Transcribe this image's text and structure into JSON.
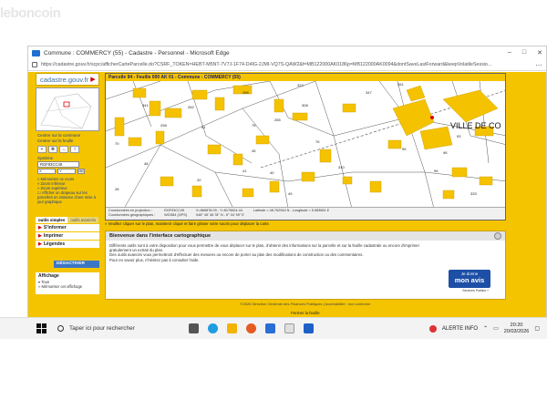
{
  "watermark": "leboncoin",
  "browser": {
    "title": "Commune : COMMERCY (55) - Cadastre - Personnel - Microsoft Edge",
    "url": "https://cadastre.gouv.fr/scpc/afficherCarteParcelle.do?CSRF_TOKEN=HEBT-M5NT-7V7J-1F74-D4IG-2JMI-VQ7S-QAW2&f=MB122000AK0186p=MB122000AK0094&dontSaveLastForward&keepVolatileSessio..."
  },
  "sidebar": {
    "logo": "cadastre.gouv.fr",
    "nav_links": [
      "Centrer sur la commune",
      "Centrer sur la feuille"
    ],
    "tool_icons": [
      "zoom-icon",
      "pan-icon",
      "measure-icon",
      "info-icon"
    ],
    "system_label": "Système",
    "system_value": "RGF93CC49",
    "coord_placeholder_x": "X",
    "coord_placeholder_y": "Y",
    "coord_ok": "OK",
    "tools_links": [
      "Mémoriser ce cours",
      "Zoom inférieur",
      "Zoom supérieur",
      "Afficher un drapeau sur les parcelles en instance d'une mise à jour graphique"
    ],
    "tabs": [
      "outils simples",
      "outils avancés"
    ],
    "menu": [
      "S'informer",
      "Imprimer",
      "Légendes"
    ],
    "deactivate": "DÉSACTIVER",
    "display_title": "Affichage",
    "display_options": [
      "Tous",
      "Mémoriser cet affichage"
    ]
  },
  "map": {
    "header": "Parcelle 94 - Feuille 000 AK 01 - Commune : COMMERCY (55)",
    "town_label": "VILLE DE CO",
    "parcel_numbers": [
      "341",
      "262",
      "266",
      "322",
      "298",
      "70",
      "51",
      "48",
      "75",
      "265",
      "308",
      "347",
      "95",
      "98",
      "76",
      "261",
      "45",
      "310",
      "41",
      "40",
      "93",
      "96",
      "49",
      "20",
      "28",
      "333"
    ],
    "status": {
      "col1": [
        "Coordonnées en projection :",
        "Coordonnées géographiques :"
      ],
      "col2": [
        "RGF93CC49",
        "WGS84 (GPS)"
      ],
      "col3": [
        "X=866878.09 - Y=8175624.44",
        "048° 45' 45.78\" N - 5° 34' 59\" E"
      ],
      "col4": [
        "",
        "Latitude = 48.762944 N - Longitude = 5.583661 E"
      ]
    },
    "hint": "Veuillez cliquer sur le plan, maintenir cliqué et faire glisser votre souris pour déplacer la carte."
  },
  "info": {
    "title": "Bienvenue dans l'interface cartographique",
    "paragraphs": [
      "Différents outils sont à votre disposition pour vous permettre de vous déplacer sur le plan, d'obtenir des informations sur la parcelle et sur la feuille cadastrale ou encore d'imprimer gratuitement un extrait du plan.",
      "Des outils avancés vous permettront d'effectuer des mesures ou encore de porter au plan des modifications de construction ou des commentaires.",
      "Pour en savoir plus, n'hésitez pas à consulter l'aide."
    ],
    "avis_small": "Je donne",
    "avis_big": "mon avis",
    "avis_sub": "Services Publics +"
  },
  "footer": {
    "copyright": "©2026 Direction Générale des Finances Publiques  |  Accessibilité : non conforme",
    "close": "Fermer la feuille"
  },
  "taskbar": {
    "search_placeholder": "Taper ici pour rechercher",
    "alert_text": "ALERTE INFO",
    "time": "20:20",
    "date": "20/03/2026"
  },
  "colors": {
    "page_background": "#f4c400",
    "building": "#f5c200",
    "accent_blue": "#1d4fa6"
  }
}
